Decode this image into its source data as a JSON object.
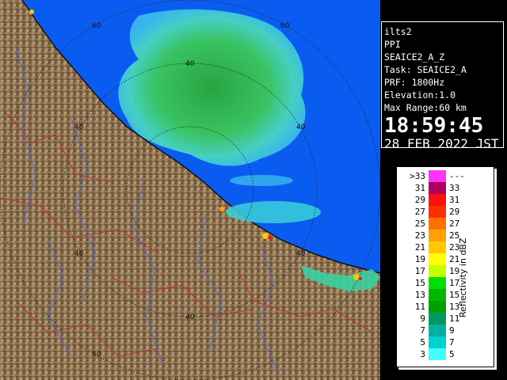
{
  "info": {
    "station": "ilts2",
    "mode": "PPI",
    "product": "SEAICE2_A_Z",
    "task": "Task: SEAICE2_A",
    "prf": "PRF: 1800Hz",
    "elevation": "Elevation:1.0",
    "max_range": "Max Range:60 km",
    "time": "18:59:45",
    "date": "28 FEB 2022 JST"
  },
  "colors": {
    "sea": "#0a5cf0",
    "land": "#8c7355",
    "water_echo_light": "#3ad6e8",
    "water_echo_green": "#2cc04a"
  },
  "range_ring_labels": [
    "60",
    "40",
    "40",
    "60",
    "40",
    "40",
    "40",
    "40",
    "60"
  ],
  "legend": {
    "title": "Reflectivity in dBZ",
    "rows": [
      {
        "lo": ">33",
        "hi": "---",
        "color": "#ff33ff"
      },
      {
        "lo": "31",
        "hi": "33",
        "color": "#b00060"
      },
      {
        "lo": "29",
        "hi": "31",
        "color": "#ff1010"
      },
      {
        "lo": "27",
        "hi": "29",
        "color": "#ff3000"
      },
      {
        "lo": "25",
        "hi": "27",
        "color": "#ff7000"
      },
      {
        "lo": "23",
        "hi": "25",
        "color": "#ffa000"
      },
      {
        "lo": "21",
        "hi": "23",
        "color": "#ffc800"
      },
      {
        "lo": "19",
        "hi": "21",
        "color": "#ffff00"
      },
      {
        "lo": "17",
        "hi": "19",
        "color": "#c8ff00"
      },
      {
        "lo": "15",
        "hi": "17",
        "color": "#00e000"
      },
      {
        "lo": "13",
        "hi": "15",
        "color": "#00b800"
      },
      {
        "lo": "11",
        "hi": "13",
        "color": "#00a000"
      },
      {
        "lo": "9",
        "hi": "11",
        "color": "#009a60"
      },
      {
        "lo": "7",
        "hi": "9",
        "color": "#00b0a0"
      },
      {
        "lo": "5",
        "hi": "7",
        "color": "#00d0d0"
      },
      {
        "lo": "3",
        "hi": "5",
        "color": "#40ffff"
      }
    ]
  }
}
